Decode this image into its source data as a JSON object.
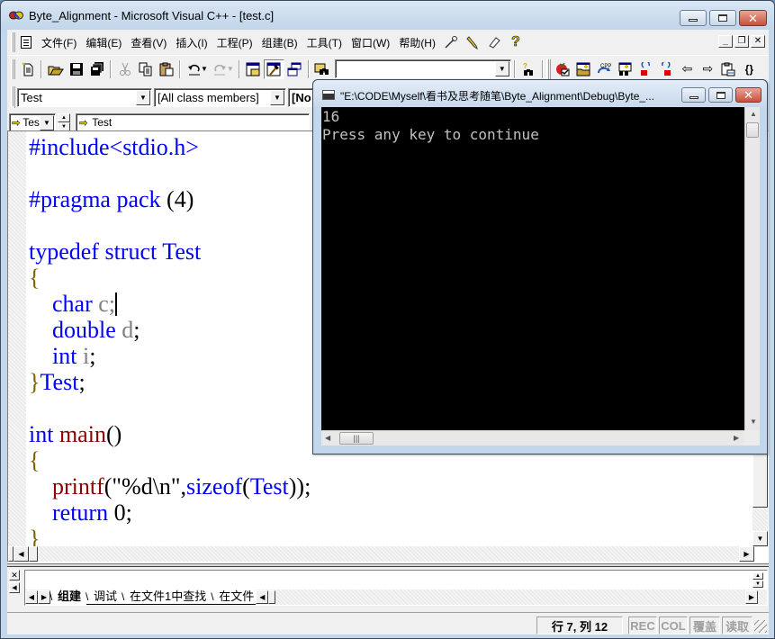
{
  "window": {
    "title": "Byte_Alignment - Microsoft Visual C++ - [test.c]",
    "controls": {
      "minimize": "minimize",
      "maximize": "maximize",
      "close": "close"
    }
  },
  "menubar": {
    "items": [
      {
        "label": "文件(F)"
      },
      {
        "label": "编辑(E)"
      },
      {
        "label": "查看(V)"
      },
      {
        "label": "插入(I)"
      },
      {
        "label": "工程(P)"
      },
      {
        "label": "组建(B)"
      },
      {
        "label": "工具(T)"
      },
      {
        "label": "窗口(W)"
      },
      {
        "label": "帮助(H)"
      }
    ],
    "tool_icons": [
      "wizard-wand-icon",
      "pencil-icon",
      "eraser-icon",
      "help-question-icon"
    ],
    "mdi": {
      "minimize": "_",
      "restore": "❐",
      "close": "✕"
    }
  },
  "toolbar_standard": {
    "buttons": [
      "new-file",
      "open",
      "save",
      "save-all",
      "cut",
      "copy",
      "paste",
      "undo",
      "redo",
      "workspace",
      "output",
      "window-list",
      "find-in-files"
    ],
    "find_combo_value": "",
    "find_button": "find"
  },
  "toolbar_build": {
    "buttons": [
      "compile",
      "build",
      "build-cpp",
      "find-build",
      "bookmark-prev",
      "bookmark-next",
      "back",
      "forward",
      "paste-special",
      "braces"
    ]
  },
  "wizardbar": {
    "class_combo": "Test",
    "members_combo": "[All class members]",
    "filter_combo": "[No"
  },
  "navbar": {
    "scope_combo": "Test",
    "symbol_field": "Test"
  },
  "editor": {
    "lines": [
      [
        {
          "t": "#include<stdio.h>",
          "c": "pp"
        }
      ],
      [],
      [
        {
          "t": "#pragma pack ",
          "c": "pp"
        },
        {
          "t": "(4)",
          "c": "bk"
        }
      ],
      [],
      [
        {
          "t": "typedef struct Test",
          "c": "kw"
        }
      ],
      [
        {
          "t": "{",
          "c": "br"
        }
      ],
      [
        {
          "t": "    ",
          "c": "bk"
        },
        {
          "t": "char",
          "c": "kw"
        },
        {
          "t": " c;",
          "c": "id"
        },
        {
          "t": "|caret|",
          "c": "caret"
        }
      ],
      [
        {
          "t": "    ",
          "c": "bk"
        },
        {
          "t": "double",
          "c": "kw"
        },
        {
          "t": " d",
          "c": "id"
        },
        {
          "t": ";",
          "c": "bk"
        }
      ],
      [
        {
          "t": "    ",
          "c": "bk"
        },
        {
          "t": "int",
          "c": "kw"
        },
        {
          "t": " i",
          "c": "id"
        },
        {
          "t": ";",
          "c": "bk"
        }
      ],
      [
        {
          "t": "}",
          "c": "br"
        },
        {
          "t": "Test",
          "c": "kw"
        },
        {
          "t": ";",
          "c": "bk"
        }
      ],
      [],
      [
        {
          "t": "int ",
          "c": "kw"
        },
        {
          "t": "main",
          "c": "fn"
        },
        {
          "t": "()",
          "c": "bk"
        }
      ],
      [
        {
          "t": "{",
          "c": "br"
        }
      ],
      [
        {
          "t": "    ",
          "c": "bk"
        },
        {
          "t": "printf",
          "c": "fn"
        },
        {
          "t": "(\"%d\\n\",",
          "c": "bk"
        },
        {
          "t": "sizeof",
          "c": "kw"
        },
        {
          "t": "(",
          "c": "bk"
        },
        {
          "t": "Test",
          "c": "kw"
        },
        {
          "t": "));",
          "c": "bk"
        }
      ],
      [
        {
          "t": "    ",
          "c": "bk"
        },
        {
          "t": "return",
          "c": "kw"
        },
        {
          "t": " 0;",
          "c": "bk"
        }
      ],
      [
        {
          "t": "}",
          "c": "br"
        }
      ]
    ]
  },
  "output_pane": {
    "tabs": [
      {
        "label": "组建",
        "active": true
      },
      {
        "label": "调试",
        "active": false
      },
      {
        "label": "在文件1中查找",
        "active": false
      },
      {
        "label": "在文件",
        "active": false
      }
    ]
  },
  "statusbar": {
    "position": "行 7, 列 12",
    "rec": "REC",
    "col": "COL",
    "overwrite": "覆盖",
    "readonly": "读取"
  },
  "console": {
    "title": "\"E:\\CODE\\Myself\\看书及思考随笔\\Byte_Alignment\\Debug\\Byte_...",
    "output_lines": [
      "16",
      "Press any key to continue"
    ]
  },
  "colors": {
    "keyword": "#0000ff",
    "identifier": "#808080",
    "function": "#8b0000",
    "brace": "#806000",
    "console_bg": "#000000",
    "console_fg": "#c0c0c0",
    "close_button": "#c8503c"
  }
}
